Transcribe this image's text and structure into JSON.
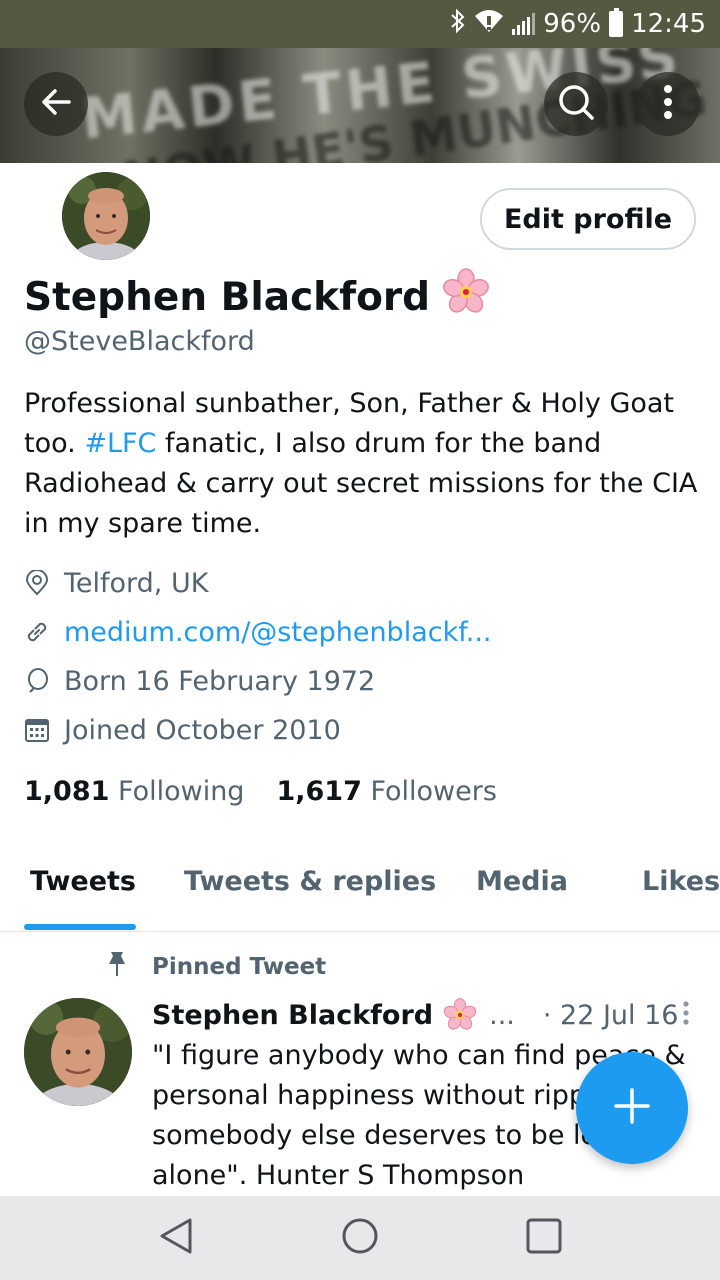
{
  "status_bar": {
    "battery": "96%",
    "time": "12:45"
  },
  "banner": {
    "line1": "MADE THE SWISS",
    "line2": "NOW HE'S MUNCHING C"
  },
  "profile": {
    "name": "Stephen Blackford",
    "name_emoji": "🌸",
    "handle": "@SteveBlackford",
    "edit_label": "Edit profile",
    "bio_part1": "Professional sunbather, Son, Father & Holy Goat too. ",
    "bio_hashtag": "#LFC",
    "bio_part2": " fanatic, I also drum for the band Radiohead & carry out secret missions for the CIA in my spare time.",
    "location": "Telford, UK",
    "link": "medium.com/@stephenblackf...",
    "born": "Born 16 February 1972",
    "joined": "Joined October 2010",
    "following_count": "1,081",
    "following_label": "Following",
    "followers_count": "1,617",
    "followers_label": "Followers"
  },
  "tabs": [
    "Tweets",
    "Tweets & replies",
    "Media",
    "Likes"
  ],
  "pinned_tweet": {
    "label": "Pinned Tweet",
    "author": "Stephen Blackford",
    "author_emoji": "🌸",
    "ellipsis": "...",
    "date": "· 22 Jul 16",
    "text": "\"I figure anybody who can find peace & personal happiness without ripping off somebody else deserves to be left alone\". Hunter S Thompson"
  },
  "colors": {
    "accent": "#1d9bf0",
    "secondary_text": "#536471",
    "status_bar": "#545a42"
  },
  "icons": [
    "bluetooth-icon",
    "wifi-icon",
    "signal-icon",
    "battery-icon",
    "back-arrow-icon",
    "search-icon",
    "more-vertical-icon",
    "location-icon",
    "link-icon",
    "balloon-icon",
    "calendar-icon",
    "pin-icon",
    "compose-plus-icon",
    "nav-back-icon",
    "nav-home-icon",
    "nav-recents-icon"
  ]
}
